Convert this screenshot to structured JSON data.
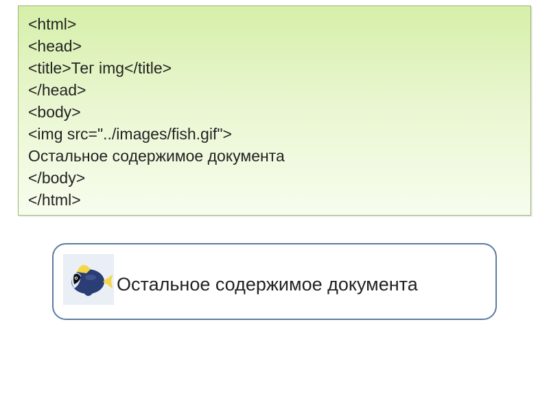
{
  "code": {
    "lines": [
      "<html>",
      "<head>",
      "<title>Тег img</title>",
      "</head>",
      "<body>",
      "<img src=\"../images/fish.gif\">",
      "Остальное содержимое документа",
      "</body>",
      "</html>"
    ]
  },
  "result": {
    "text": "Остальное содержимое документа",
    "image_alt": "fish"
  }
}
